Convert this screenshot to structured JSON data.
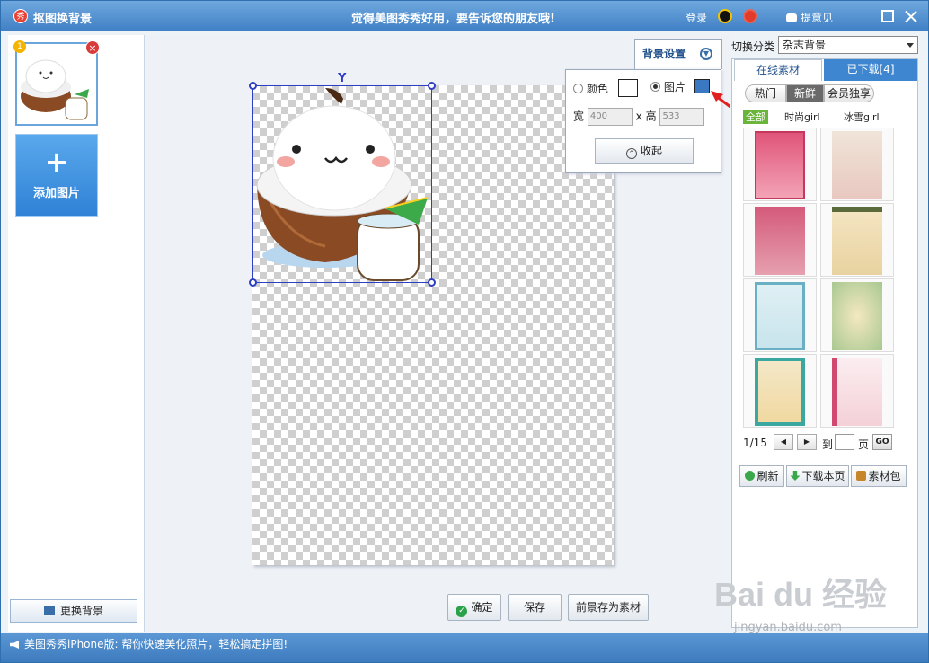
{
  "titlebar": {
    "app_logo": "秀",
    "title": "抠图换背景",
    "slogan": "觉得美图秀秀好用，要告诉您的朋友哦!",
    "login": "登录",
    "feedback": "提意见"
  },
  "left_panel": {
    "thumb_badge": "1",
    "thumb_close": "×",
    "add_image_plus": "+",
    "add_image_label": "添加图片",
    "change_bg_label": "更换背景"
  },
  "canvas": {
    "confirm_label": "确定",
    "confirm_icon": "✓",
    "save_label": "保存",
    "save_material_label": "前景存为素材"
  },
  "bg_settings": {
    "tab_label": "背景设置",
    "color_label": "颜色",
    "image_label": "图片",
    "width_label": "宽",
    "width_value": "400",
    "times": "x",
    "height_label": "高",
    "height_value": "533",
    "collapse_label": "收起",
    "collapse_icon": "^"
  },
  "right_panel": {
    "category_label": "切换分类",
    "category_value": "杂志背景",
    "tab_online": "在线素材",
    "tab_downloaded": "已下载[4]",
    "pills": [
      "热门",
      "新鲜",
      "会员独享"
    ],
    "filters": [
      "全部",
      "时尚girl",
      "冰雪girl"
    ],
    "page_indicator": "1/15",
    "prev": "◀",
    "next": "▶",
    "goto_label": "到",
    "page_label": "页",
    "go_label": "GO",
    "refresh_label": "刷新",
    "download_page_label": "下载本页",
    "material_pack_label": "素材包"
  },
  "statusbar": {
    "text": "美图秀秀iPhone版: 帮你快速美化照片，轻松搞定拼图!"
  },
  "watermark": {
    "brand": "Bai du 经验",
    "url": "jingyan.baidu.com"
  },
  "colors": {
    "accent": "#3f86d0",
    "selection": "#2d3fc4",
    "arrow": "#e02020"
  }
}
